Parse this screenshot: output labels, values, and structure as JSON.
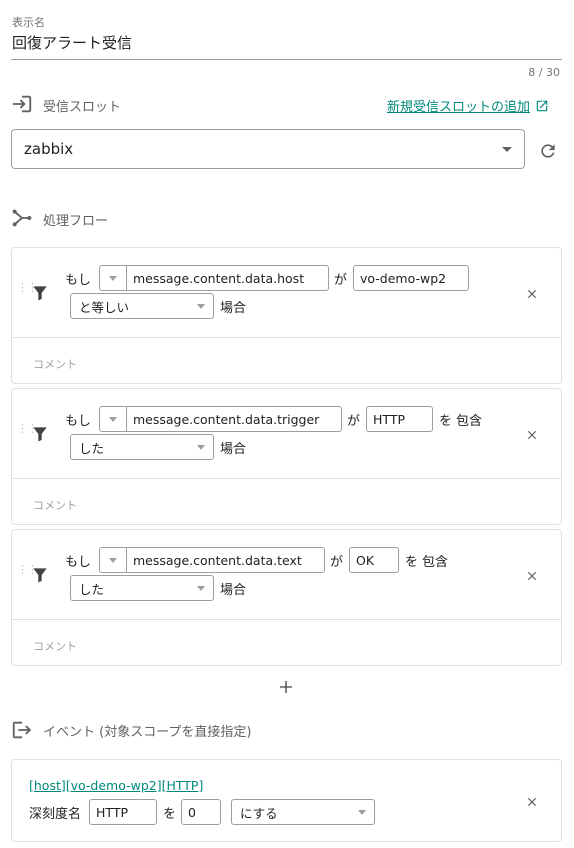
{
  "display_name": {
    "label": "表示名",
    "value": "回復アラート受信",
    "counter": "8 / 30"
  },
  "receive_slot": {
    "title": "受信スロット",
    "add_link": "新規受信スロットの追加",
    "selected": "zabbix",
    "icon": "login-icon"
  },
  "flow": {
    "title": "処理フロー",
    "icon": "branch-icon",
    "conditions": [
      {
        "prefix": "もし",
        "field": "message.content.data.host",
        "ga": "が",
        "value": "vo-demo-wp2",
        "wo": "",
        "contains": "",
        "operator": "と等しい",
        "suffix": "場合",
        "comment_placeholder": "コメント"
      },
      {
        "prefix": "もし",
        "field": "message.content.data.trigger",
        "ga": "が",
        "value": "HTTP",
        "wo": "を",
        "contains": "包含",
        "operator": "した",
        "suffix": "場合",
        "comment_placeholder": "コメント"
      },
      {
        "prefix": "もし",
        "field": "message.content.data.text",
        "ga": "が",
        "value": "OK",
        "wo": "を",
        "contains": "包含",
        "operator": "した",
        "suffix": "場合",
        "comment_placeholder": "コメント"
      }
    ]
  },
  "event": {
    "title": "イベント (対象スコープを直接指定)",
    "icon": "logout-icon",
    "tag": "[host][vo-demo-wp2][HTTP]",
    "severity_label": "深刻度名",
    "severity_value": "HTTP",
    "wo": "を",
    "level": "0",
    "action": "にする"
  },
  "colors": {
    "accent": "#00897b",
    "border": "#9e9e9e",
    "divider": "#e0e0e0"
  }
}
